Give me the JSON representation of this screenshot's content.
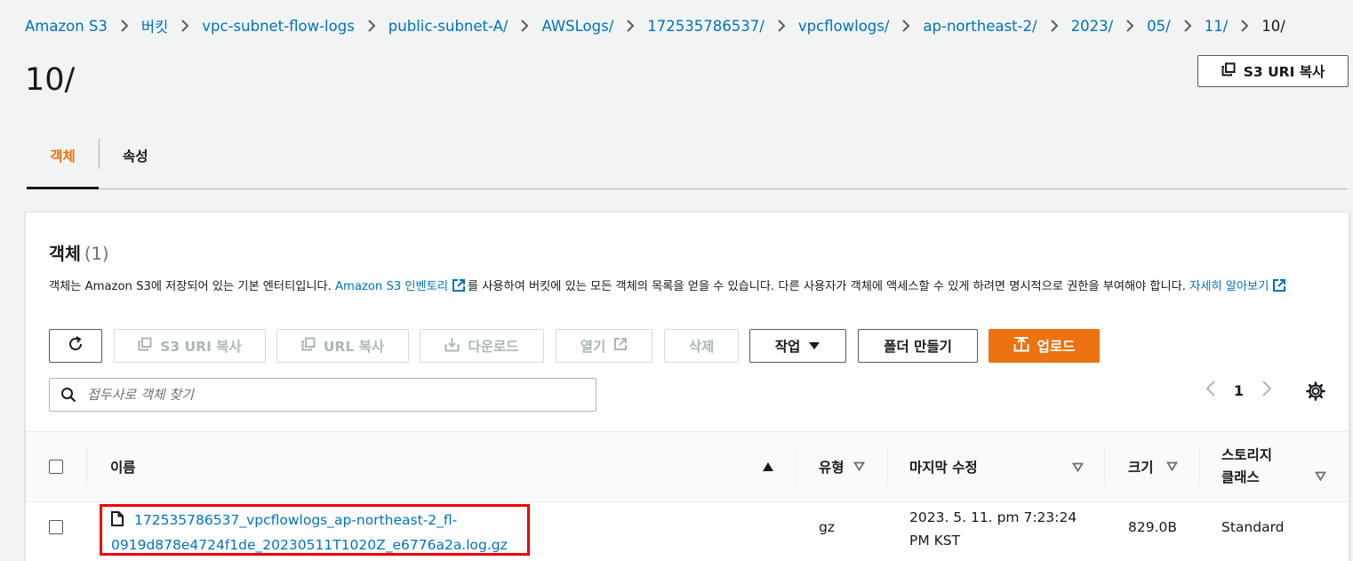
{
  "breadcrumb": [
    "Amazon S3",
    "버킷",
    "vpc-subnet-flow-logs",
    "public-subnet-A/",
    "AWSLogs/",
    "172535786537/",
    "vpcflowlogs/",
    "ap-northeast-2/",
    "2023/",
    "05/",
    "11/",
    "10/"
  ],
  "page": {
    "title": "10/",
    "copy_uri_label": "S3 URI 복사"
  },
  "tabs": [
    {
      "label": "객체",
      "active": true
    },
    {
      "label": "속성",
      "active": false
    }
  ],
  "objects": {
    "title": "객체",
    "count": "(1)",
    "desc_part1": "객체는 Amazon S3에 저장되어 있는 기본 엔터티입니다. ",
    "desc_link1": "Amazon S3 인벤토리",
    "desc_part2": "를 사용하여 버킷에 있는 모든 객체의 목록을 얻을 수 있습니다. 다른 사용자가 객체에 액세스할 수 있게 하려면 명시적으로 권한을 부여해야 합니다. ",
    "desc_link2": "자세히 알아보기"
  },
  "toolbar": {
    "copy_s3_uri": "S3 URI 복사",
    "copy_url": "URL 복사",
    "download": "다운로드",
    "open": "열기",
    "delete": "삭제",
    "actions": "작업",
    "create_folder": "폴더 만들기",
    "upload": "업로드"
  },
  "search": {
    "placeholder": "접두사로 객체 찾기"
  },
  "pagination": {
    "page": "1"
  },
  "table": {
    "headers": {
      "name": "이름",
      "type": "유형",
      "modified": "마지막 수정",
      "size": "크기",
      "storage_line1": "스토리지",
      "storage_line2": "클래스"
    },
    "rows": [
      {
        "name_line1": "172535786537_vpcflowlogs_ap-northeast-2_fl-",
        "name_line2": "0919d878e4724f1de_20230511T1020Z_e6776a2a.log.gz",
        "type": "gz",
        "modified_line1": "2023. 5. 11. pm 7:23:24",
        "modified_line2": "PM KST",
        "size": "829.0B",
        "storage": "Standard"
      }
    ]
  },
  "colors": {
    "accent": "#ec7211",
    "link": "#0073bb",
    "highlight": "#e00000"
  }
}
